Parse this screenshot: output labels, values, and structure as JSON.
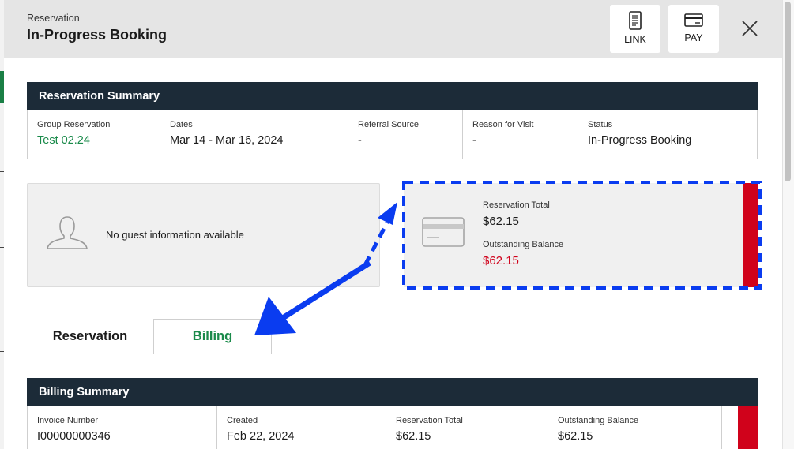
{
  "header": {
    "subtitle": "Reservation",
    "title": "In-Progress Booking",
    "link_label": "LINK",
    "pay_label": "PAY"
  },
  "summary": {
    "title": "Reservation Summary",
    "fields": [
      {
        "label": "Group Reservation",
        "value": "Test 02.24"
      },
      {
        "label": "Dates",
        "value": "Mar 14 - Mar 16, 2024"
      },
      {
        "label": "Referral Source",
        "value": "-"
      },
      {
        "label": "Reason for Visit",
        "value": "-"
      },
      {
        "label": "Status",
        "value": "In-Progress Booking"
      }
    ]
  },
  "guest": {
    "message": "No guest information available"
  },
  "totals": {
    "total_label": "Reservation Total",
    "total_value": "$62.15",
    "balance_label": "Outstanding Balance",
    "balance_value": "$62.15"
  },
  "tabs": [
    {
      "label": "Reservation"
    },
    {
      "label": "Billing"
    }
  ],
  "billing": {
    "title": "Billing Summary",
    "fields": [
      {
        "label": "Invoice Number",
        "value": "I00000000346"
      },
      {
        "label": "Created",
        "value": "Feb 22, 2024"
      },
      {
        "label": "Reservation Total",
        "value": "$62.15"
      },
      {
        "label": "Outstanding Balance",
        "value": "$62.15"
      }
    ]
  },
  "colors": {
    "header_bg": "#e5e5e5",
    "section_bar": "#1c2b38",
    "accent_green": "#1a8a4a",
    "alert_red": "#d0021b",
    "annotation_blue": "#0a3cf0"
  },
  "icons": [
    "link-icon",
    "pay-card-icon",
    "close-icon",
    "guest-avatar-icon",
    "credit-card-icon"
  ]
}
